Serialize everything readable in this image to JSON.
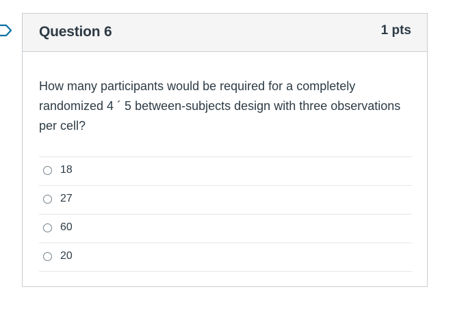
{
  "question": {
    "title": "Question 6",
    "points": "1 pts",
    "text": "How many participants would be required for a completely randomized 4 ´ 5 between-subjects design with three observations per cell?",
    "answers": [
      {
        "label": "18"
      },
      {
        "label": "27"
      },
      {
        "label": "60"
      },
      {
        "label": "20"
      }
    ]
  },
  "icons": {
    "flag": "flag-question-icon"
  },
  "colors": {
    "header_bg": "#f5f5f5",
    "border": "#c7cdd1",
    "text": "#2d3b45",
    "flag": "#0770a3"
  }
}
